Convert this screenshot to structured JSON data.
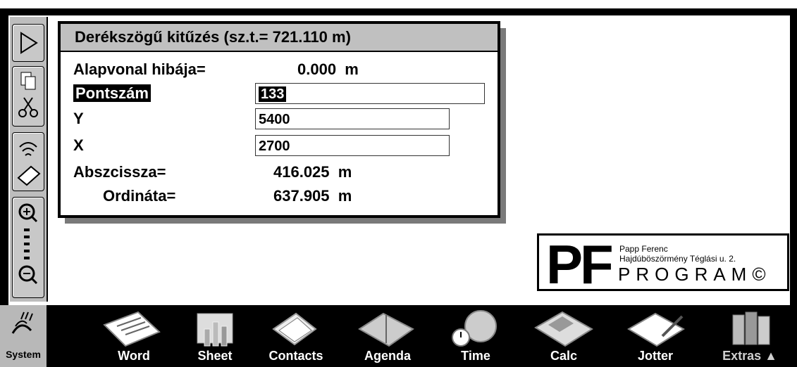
{
  "topbar": {
    "ghost_text": ""
  },
  "dialog": {
    "title": "Derékszögű kitűzés  (sz.t.= 721.110 m)",
    "baseline_error_label": "Alapvonal hibája=",
    "baseline_error_value": "0.000  m",
    "point_label": "Pontszám",
    "point_value": "133",
    "y_label": "Y",
    "y_value": "5400",
    "x_label": "X",
    "x_value": "2700",
    "abscissa_label": "Abszcissza=",
    "abscissa_value": "416.025  m",
    "ordinate_label": "Ordináta=",
    "ordinate_value": "637.905  m"
  },
  "logo": {
    "mark": "PF",
    "line1": "Papp Ferenc",
    "line2": "Hajdúböszörmény Téglási u. 2.",
    "line3": "PROGRAM©"
  },
  "appbar": {
    "system": "System",
    "word": "Word",
    "sheet": "Sheet",
    "contacts": "Contacts",
    "agenda": "Agenda",
    "time": "Time",
    "calc": "Calc",
    "jotter": "Jotter",
    "extras": "Extras ▲"
  },
  "colors": {
    "toolbar": "#bdbdbd",
    "title_bar": "#c0c0c0",
    "appbar": "#000000"
  }
}
